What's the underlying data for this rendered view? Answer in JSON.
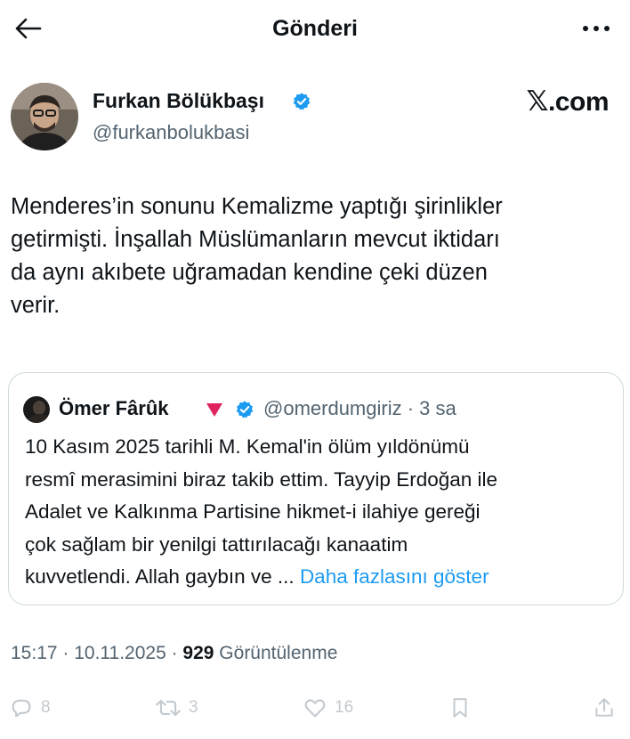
{
  "header": {
    "title": "Gönderi"
  },
  "author": {
    "name": "Furkan Bölükbaşı",
    "handle": "@furkanbolukbasi",
    "verified": true
  },
  "watermark": {
    "x_glyph": "𝕏",
    "text": ".com"
  },
  "tweet": {
    "text": "Menderes’in sonunu Kemalizme yaptığı şirinlikler\ngetirmişti. İnşallah Müslümanların mevcut iktidarı\nda aynı akıbete uğramadan kendine çeki düzen\nverir."
  },
  "quote": {
    "name": "Ömer Fârûk",
    "handle_time": "@omerdumgiriz · 3 sa",
    "verified": true,
    "text": "10 Kasım 2025 tarihli M. Kemal'in ölüm yıldönümü\nresmî merasimini biraz takib ettim. Tayyip Erdoğan ile\nAdalet ve Kalkınma Partisine hikmet-i ilahiye gereği\nçok sağlam bir yenilgi tattırılacağı kanaatim\nkuvvetlendi. Allah gaybın ve ... ",
    "show_more": "Daha fazlasını göster"
  },
  "meta": {
    "time_date": "15:17 · 10.11.2025 · ",
    "views_count": "929",
    "views_label": " Görüntülenme"
  },
  "actions": {
    "reply_count": "8",
    "retweet_count": "3",
    "like_count": "16"
  },
  "colors": {
    "accent": "#1d9bf0",
    "secondary_text": "#536471",
    "border": "#cfd9de",
    "flag_red": "#e0245e"
  }
}
